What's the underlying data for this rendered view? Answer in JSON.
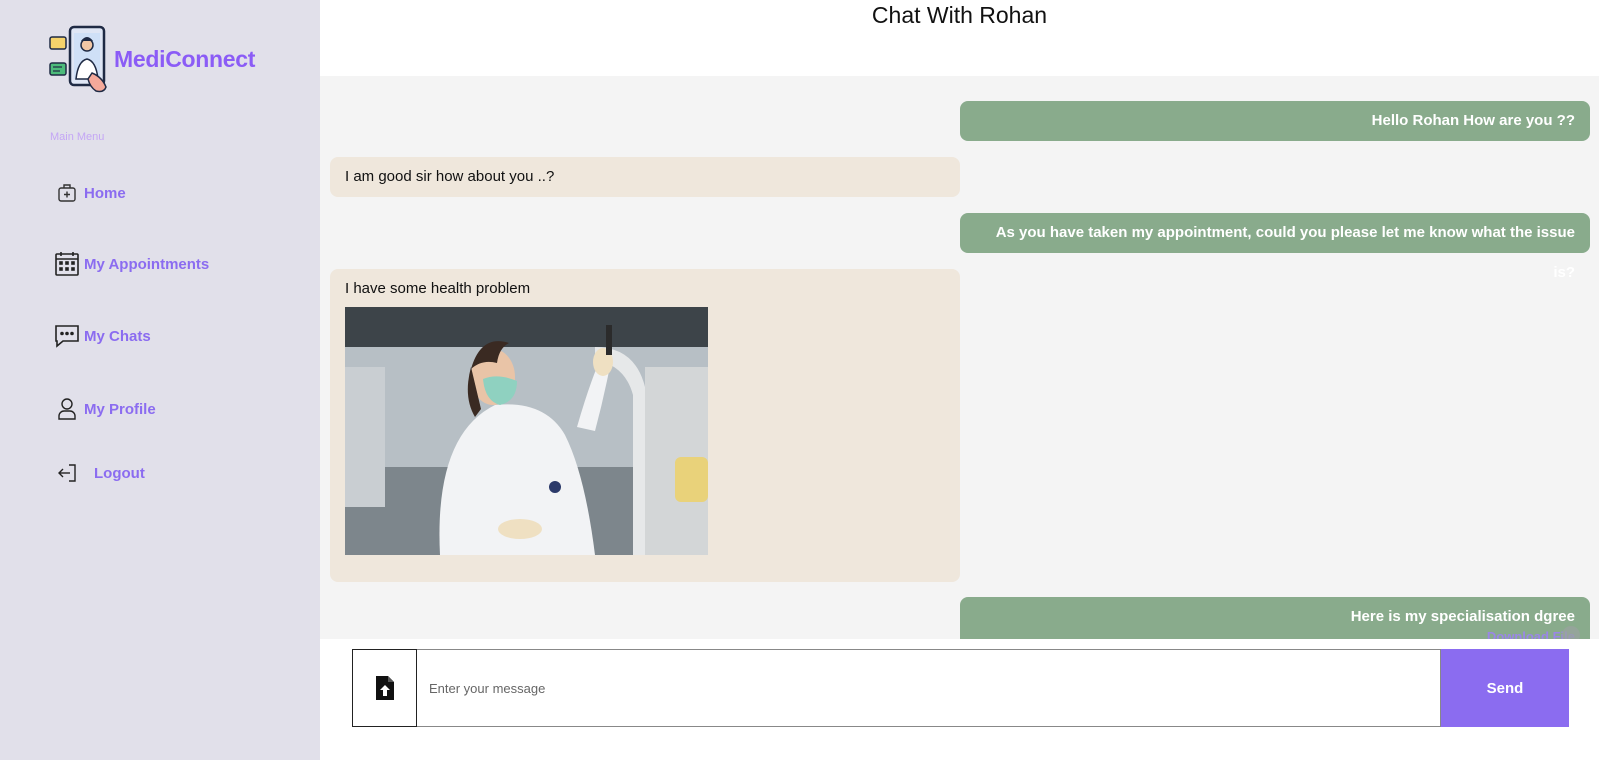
{
  "sidebar": {
    "brand": "MediConnect",
    "menu_heading": "Main Menu",
    "items": [
      {
        "label": "Home",
        "icon": "medical-bag-icon"
      },
      {
        "label": "My Appointments",
        "icon": "calendar-icon"
      },
      {
        "label": "My Chats",
        "icon": "chat-bubble-icon"
      },
      {
        "label": "My Profile",
        "icon": "user-icon"
      },
      {
        "label": "Logout",
        "icon": "logout-icon"
      }
    ]
  },
  "chat": {
    "title": "Chat With Rohan",
    "messages": [
      {
        "direction": "out",
        "text": "Hello Rohan How are you ??"
      },
      {
        "direction": "in",
        "text": "I am good sir how about you ..?"
      },
      {
        "direction": "out",
        "text": "As you have taken my appointment, could you please let me know what the issue is?"
      },
      {
        "direction": "in",
        "text": "I have some health problem",
        "attachment": "photo"
      },
      {
        "direction": "out",
        "text": "Here is my specialisation dgree",
        "link": "Download File"
      }
    ]
  },
  "composer": {
    "placeholder": "Enter your message",
    "send_label": "Send",
    "upload_icon": "file-upload-icon"
  },
  "colors": {
    "sidebar_bg": "#e1e0ea",
    "accent": "#8b6cf0",
    "outgoing_bubble": "#89ab8c",
    "incoming_bubble": "#efe7dc"
  }
}
